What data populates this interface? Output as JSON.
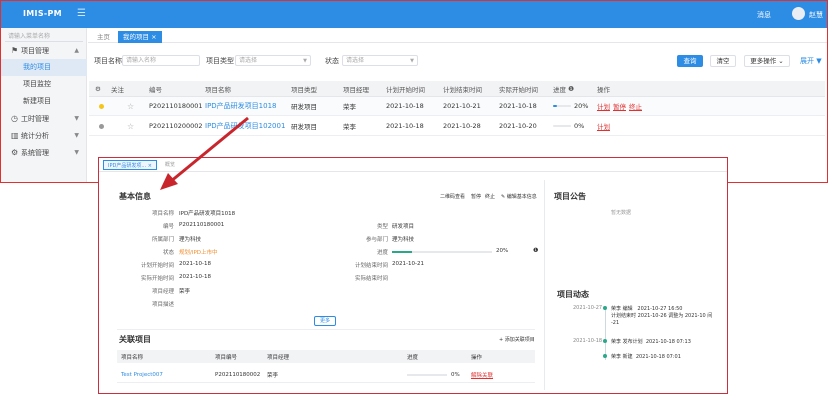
{
  "app": {
    "title": "IMIS-PM",
    "messages_label": "消息",
    "user_name": "赵慧"
  },
  "sidebar": {
    "search_placeholder": "请输入菜单名称",
    "items": [
      {
        "label": "项目管理",
        "icon": "flag-icon",
        "expanded": true
      },
      {
        "label": "我的项目",
        "sub": true,
        "active": true
      },
      {
        "label": "项目监控",
        "sub": true
      },
      {
        "label": "新建项目",
        "sub": true
      },
      {
        "label": "工时管理",
        "icon": "clock-icon"
      },
      {
        "label": "统计分析",
        "icon": "chart-icon"
      },
      {
        "label": "系统管理",
        "icon": "gear-icon"
      }
    ]
  },
  "tabs": [
    {
      "label": "主页"
    },
    {
      "label": "我的项目",
      "closable": true
    }
  ],
  "filters": {
    "name_label": "项目名称",
    "name_placeholder": "请输入名称",
    "type_label": "项目类型",
    "type_placeholder": "请选择",
    "status_label": "状态",
    "status_placeholder": "请选择",
    "search_button": "查询",
    "clear_button": "清空",
    "more_button": "更多操作",
    "expand_label": "展开"
  },
  "grid": {
    "headers": [
      "关注",
      "编号",
      "项目名称",
      "项目类型",
      "项目经理",
      "计划开始时间",
      "计划结束时间",
      "实际开始时间",
      "进度",
      "操作"
    ],
    "rows": [
      {
        "status_color": "#f5c518",
        "code": "P202110180001",
        "name": "IPD产品研发项目1018",
        "type": "研发项目",
        "manager": "荣李",
        "plan_start": "2021-10-18",
        "plan_end": "2021-10-21",
        "actual_start": "2021-10-18",
        "progress": 20,
        "progress_text": "20%",
        "ops": [
          "计划",
          "暂停",
          "终止"
        ]
      },
      {
        "status_color": "#999999",
        "code": "P202110200002",
        "name": "IPD产品研发项目102001",
        "type": "研发项目",
        "manager": "荣李",
        "plan_start": "2021-10-18",
        "plan_end": "2021-10-28",
        "actual_start": "2021-10-20",
        "progress": 0,
        "progress_text": "0%",
        "ops": [
          "计划"
        ]
      }
    ]
  },
  "detail": {
    "tabs": [
      "IPD产品研发项...",
      "概览"
    ],
    "basic_title": "基本信息",
    "actions": [
      "二维码查看",
      "暂停",
      "终止",
      "编辑基本信息"
    ],
    "fields_left": [
      {
        "label": "项目名称",
        "value": "IPD产品研发项目1018"
      },
      {
        "label": "编号",
        "value": "P202110180001"
      },
      {
        "label": "所属部门",
        "value": "理为科技"
      },
      {
        "label": "状态",
        "value": "规划/IPD上市中",
        "highlight": true
      },
      {
        "label": "计划开始时间",
        "value": "2021-10-18"
      },
      {
        "label": "实际开始时间",
        "value": "2021-10-18"
      },
      {
        "label": "项目经理",
        "value": "荣李"
      },
      {
        "label": "项目描述",
        "value": ""
      }
    ],
    "fields_right": [
      {
        "label": "类型",
        "value": "研发项目"
      },
      {
        "label": "参与部门",
        "value": "理为科技"
      },
      {
        "label": "进度",
        "value": "20%",
        "progress": 20
      },
      {
        "label": "计划结束时间",
        "value": "2021-10-21"
      },
      {
        "label": "实际结束时间",
        "value": ""
      }
    ],
    "more_button": "更多",
    "related_title": "关联项目",
    "add_related": "添加关联项目",
    "related_headers": [
      "项目名称",
      "项目编号",
      "项目经理",
      "进度",
      "操作"
    ],
    "related_rows": [
      {
        "name": "Test Project007",
        "code": "P202110180002",
        "manager": "荣李",
        "progress": 0,
        "progress_text": "0%",
        "op": "解除关联"
      }
    ],
    "notice_title": "项目公告",
    "notice_empty": "暂无数据",
    "activity_title": "项目动态",
    "activities": [
      {
        "date": "2021-10-27",
        "user": "荣李",
        "action": "编辑",
        "time": "2021-10-27 16:50",
        "detail": "计划结束时 2021-10-26 调整为 2021-10 间 -21"
      },
      {
        "date": "2021-10-18",
        "user": "荣李",
        "action": "发布计划",
        "time": "2021-10-18 07:13",
        "detail": ""
      },
      {
        "date": "",
        "user": "荣李",
        "action": "新建",
        "time": "2021-10-18 07:01",
        "detail": ""
      }
    ]
  },
  "colors": {
    "primary": "#2d8ce4",
    "frame": "#e03030",
    "status_orange": "#f08c2e",
    "progress": "#2ba88a"
  }
}
